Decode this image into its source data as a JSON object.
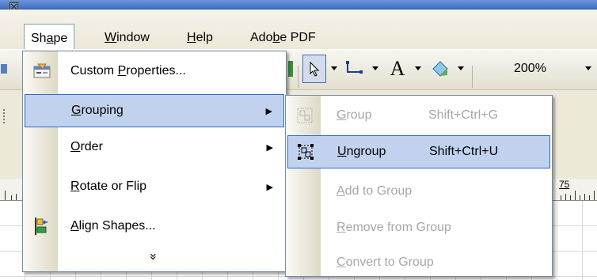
{
  "menubar": {
    "items": [
      {
        "label": "Shape",
        "mnemonic_index": 2
      },
      {
        "label": "Window",
        "mnemonic_index": 0
      },
      {
        "label": "Help",
        "mnemonic_index": 0
      },
      {
        "label": "Adobe PDF",
        "mnemonic_index": 3
      }
    ]
  },
  "toolbar": {
    "zoom_value": "200%",
    "text_tool_glyph": "A"
  },
  "ruler": {
    "label": "75"
  },
  "shape_menu": {
    "items": [
      {
        "label": "Custom Properties...",
        "mnemonic_index": 7,
        "icon": "custom-properties-icon",
        "has_submenu": false
      },
      {
        "label": "Grouping",
        "mnemonic_index": 0,
        "icon": "",
        "has_submenu": true
      },
      {
        "label": "Order",
        "mnemonic_index": 0,
        "icon": "",
        "has_submenu": true
      },
      {
        "label": "Rotate or Flip",
        "mnemonic_index": 0,
        "icon": "",
        "has_submenu": true
      },
      {
        "label": "Align Shapes...",
        "mnemonic_index": 0,
        "icon": "align-shapes-icon",
        "has_submenu": false
      }
    ],
    "more_glyph": "»"
  },
  "grouping_submenu": {
    "items": [
      {
        "label": "Group",
        "shortcut": "Shift+Ctrl+G",
        "mnemonic_index": 0,
        "enabled": false
      },
      {
        "label": "Ungroup",
        "shortcut": "Shift+Ctrl+U",
        "mnemonic_index": 0,
        "enabled": true
      },
      {
        "label": "Add to Group",
        "shortcut": "",
        "mnemonic_index": 0,
        "enabled": false
      },
      {
        "label": "Remove from Group",
        "shortcut": "",
        "mnemonic_index": 0,
        "enabled": false
      },
      {
        "label": "Convert to Group",
        "shortcut": "",
        "mnemonic_index": 0,
        "enabled": false
      }
    ]
  },
  "colors": {
    "highlight_bg": "#c1d2ee",
    "highlight_border": "#316ac5",
    "disabled_text": "#a7a6aa",
    "menubar_bg": "#ece9d8",
    "titlebar": "#3f6fc4"
  }
}
